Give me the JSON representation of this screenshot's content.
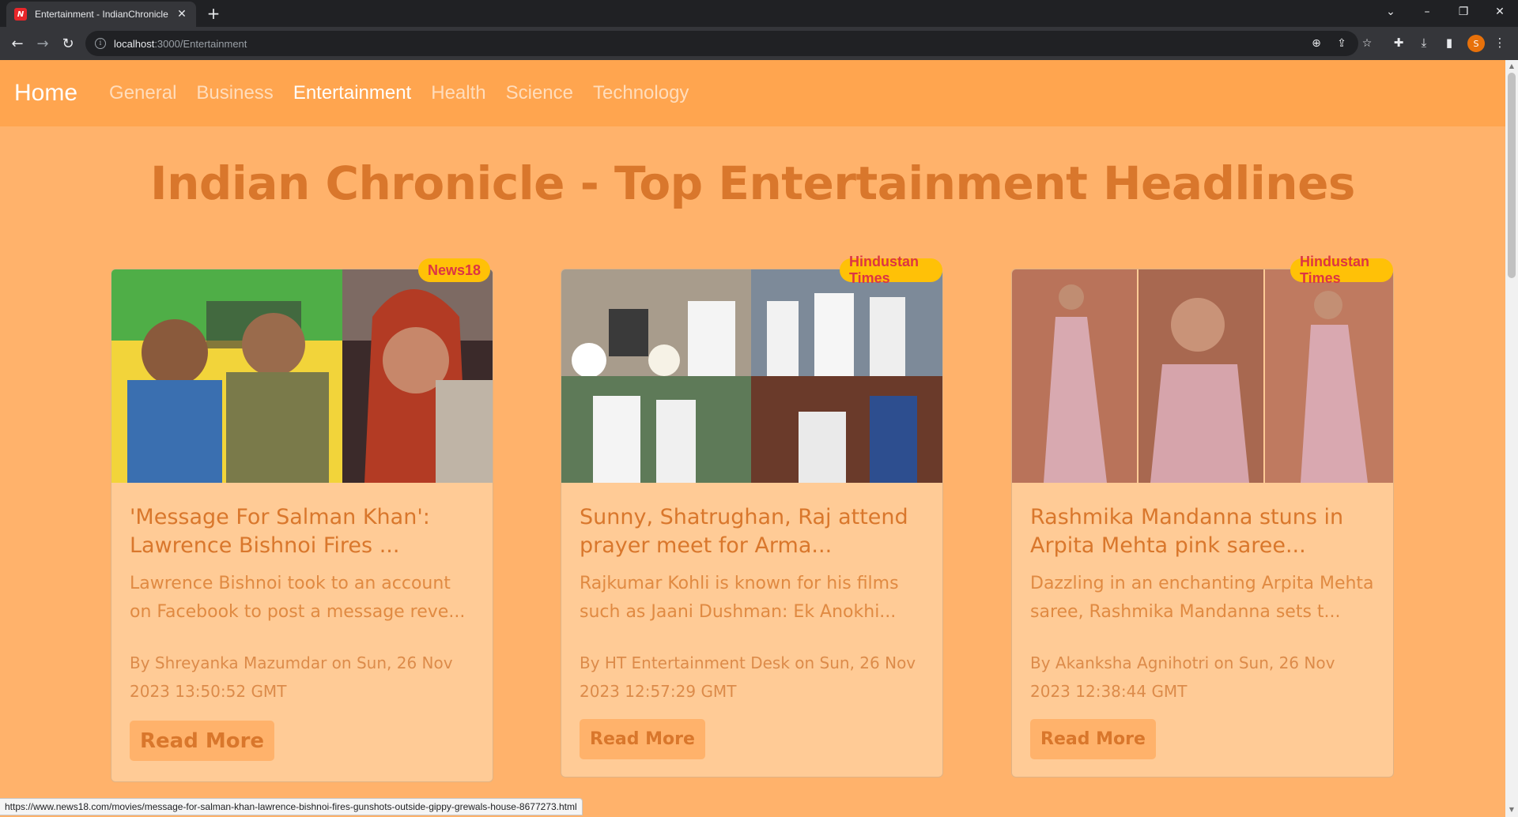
{
  "browser": {
    "tab_title": "Entertainment - IndianChronicle",
    "favicon_text": "N",
    "url_host": "localhost",
    "url_rest": ":3000/Entertainment",
    "profile_initial": "S"
  },
  "navbar": {
    "brand": "Home",
    "links": [
      "General",
      "Business",
      "Entertainment",
      "Health",
      "Science",
      "Technology"
    ],
    "active": "Entertainment"
  },
  "page": {
    "headline": "Indian Chronicle - Top Entertainment Headlines"
  },
  "cards": [
    {
      "source": "News18",
      "title": "'Message For Salman Khan': Lawrence Bishnoi Fires ...",
      "description": "Lawrence Bishnoi took to an account on Facebook to post a message reve...",
      "meta": "By Shreyanka Mazumdar on Sun, 26 Nov 2023 13:50:52 GMT",
      "button": "Read More"
    },
    {
      "source": "Hindustan Times",
      "title": "Sunny, Shatrughan, Raj attend prayer meet for Arma...",
      "description": "Rajkumar Kohli is known for his films such as Jaani Dushman: Ek Anokhi...",
      "meta": "By HT Entertainment Desk on Sun, 26 Nov 2023 12:57:29 GMT",
      "button": "Read More"
    },
    {
      "source": "Hindustan Times",
      "title": "Rashmika Mandanna stuns in Arpita Mehta pink saree...",
      "description": "Dazzling in an enchanting Arpita Mehta saree, Rashmika Mandanna sets t...",
      "meta": "By Akanksha Agnihotri on Sun, 26 Nov 2023 12:38:44 GMT",
      "button": "Read More"
    }
  ],
  "status_url": "https://www.news18.com/movies/message-for-salman-khan-lawrence-bishnoi-fires-gunshots-outside-gippy-grewals-house-8677273.html",
  "colors": {
    "page_bg": "#ffb26b",
    "navbar_bg": "#ffa54f",
    "card_bg": "#ffcb96",
    "accent_text": "#d9772c",
    "badge_bg": "#ffc107",
    "badge_text": "#dc3545"
  }
}
